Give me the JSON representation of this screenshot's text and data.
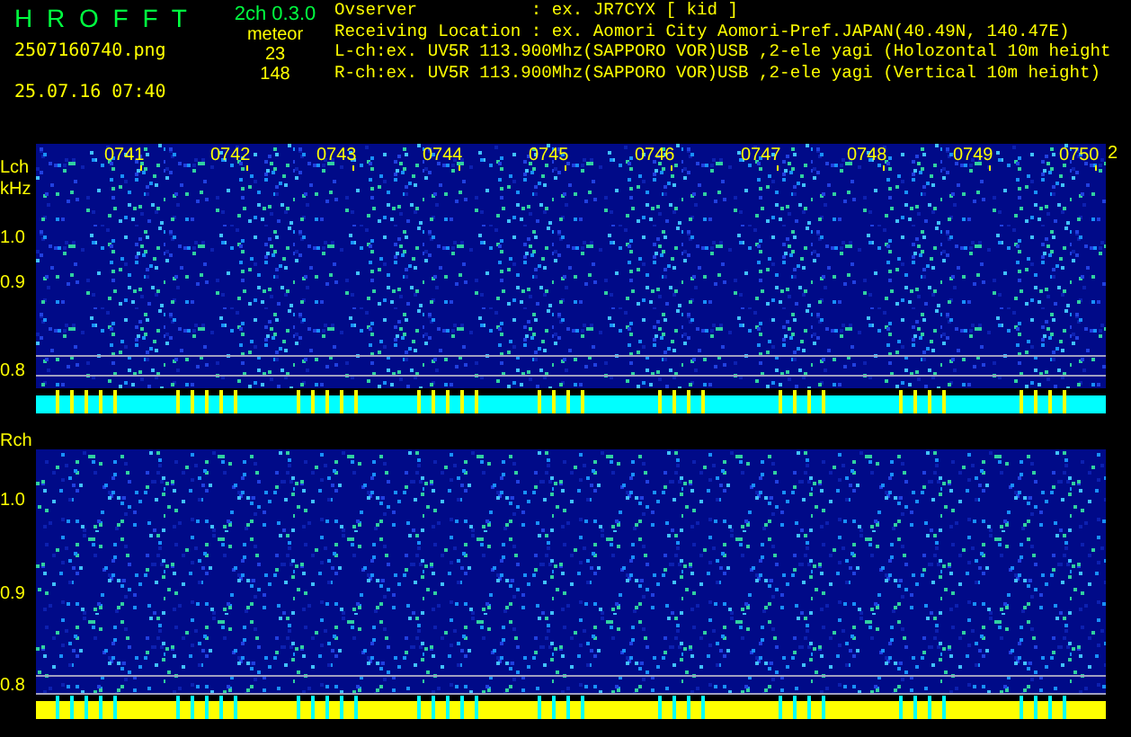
{
  "header": {
    "title": "H R O F F T",
    "version": "2ch 0.3.0",
    "filename": "2507160740.png",
    "timestamp": "25.07.16 07:40",
    "meteor_label": "meteor",
    "counts": [
      "23",
      "148"
    ]
  },
  "info": [
    "Ovserver           : ex. JR7CYX [ kid ]",
    "Receiving Location : ex. Aomori City Aomori-Pref.JAPAN(40.49N, 140.47E)",
    "L-ch:ex. UV5R 113.900Mhz(SAPPORO VOR)USB ,2-ele yagi (Holozontal 10m height",
    "R-ch:ex. UV5R 113.900Mhz(SAPPORO VOR)USB ,2-ele yagi (Vertical 10m height)"
  ],
  "panels": [
    {
      "label": "Lch",
      "unit": "kHz",
      "times": [
        "0741",
        "0742",
        "0743",
        "0744",
        "0745",
        "0746",
        "0747",
        "0748",
        "0749",
        "0750"
      ],
      "end_label": "2",
      "yticks": [
        "1.0",
        "0.9",
        "0.8"
      ],
      "color": "#00ffff"
    },
    {
      "label": "Rch",
      "yticks": [
        "1.0",
        "0.9",
        "0.8"
      ],
      "color": "#ffff00"
    }
  ]
}
